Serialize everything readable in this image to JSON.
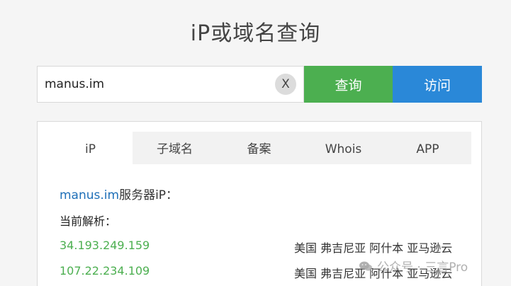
{
  "page": {
    "title": "iP或域名查询"
  },
  "search": {
    "value": "manus.im",
    "clear_label": "X",
    "query_label": "查询",
    "visit_label": "访问"
  },
  "tabs": [
    {
      "label": "iP"
    },
    {
      "label": "子域名"
    },
    {
      "label": "备案"
    },
    {
      "label": "Whois"
    },
    {
      "label": "APP"
    }
  ],
  "result": {
    "domain": "manus.im",
    "server_suffix": "服务器iP：",
    "current_label": "当前解析：",
    "rows": [
      {
        "ip": "34.193.249.159",
        "location": "美国 弗吉尼亚 阿什本 亚马逊云"
      },
      {
        "ip": "107.22.234.109",
        "location": "美国 弗吉尼亚 阿什本 亚马逊云"
      }
    ]
  },
  "watermark": {
    "text": "公众号 · 三言Pro",
    "icon": "wechat-icon"
  },
  "colors": {
    "query_button": "#4caf50",
    "visit_button": "#2a88d8",
    "ip_text": "#4caf50",
    "domain_link": "#1e6fb8"
  }
}
